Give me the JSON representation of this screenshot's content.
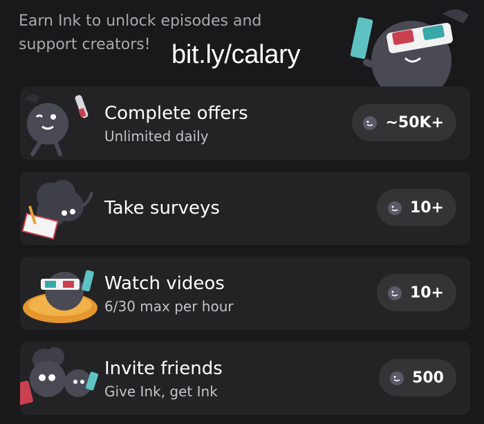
{
  "intro": {
    "text": "Earn Ink to unlock episodes and support creators!"
  },
  "promo": {
    "text": "bit.ly/calary"
  },
  "offers": [
    {
      "title": "Complete offers",
      "subtitle": "Unlimited daily",
      "reward": "~50K+",
      "icon": "ink-blob-scientist-icon"
    },
    {
      "title": "Take surveys",
      "subtitle": "",
      "reward": "10+",
      "icon": "ink-blob-survey-icon"
    },
    {
      "title": "Watch videos",
      "subtitle": "6/30 max per hour",
      "reward": "10+",
      "icon": "ink-blob-3d-glasses-icon"
    },
    {
      "title": "Invite friends",
      "subtitle": "Give Ink, get Ink",
      "reward": "500",
      "icon": "ink-blob-friends-icon"
    }
  ],
  "colors": {
    "background": "#19191b",
    "card": "#232325",
    "pill": "#343437",
    "ink": "#4b4b56"
  }
}
